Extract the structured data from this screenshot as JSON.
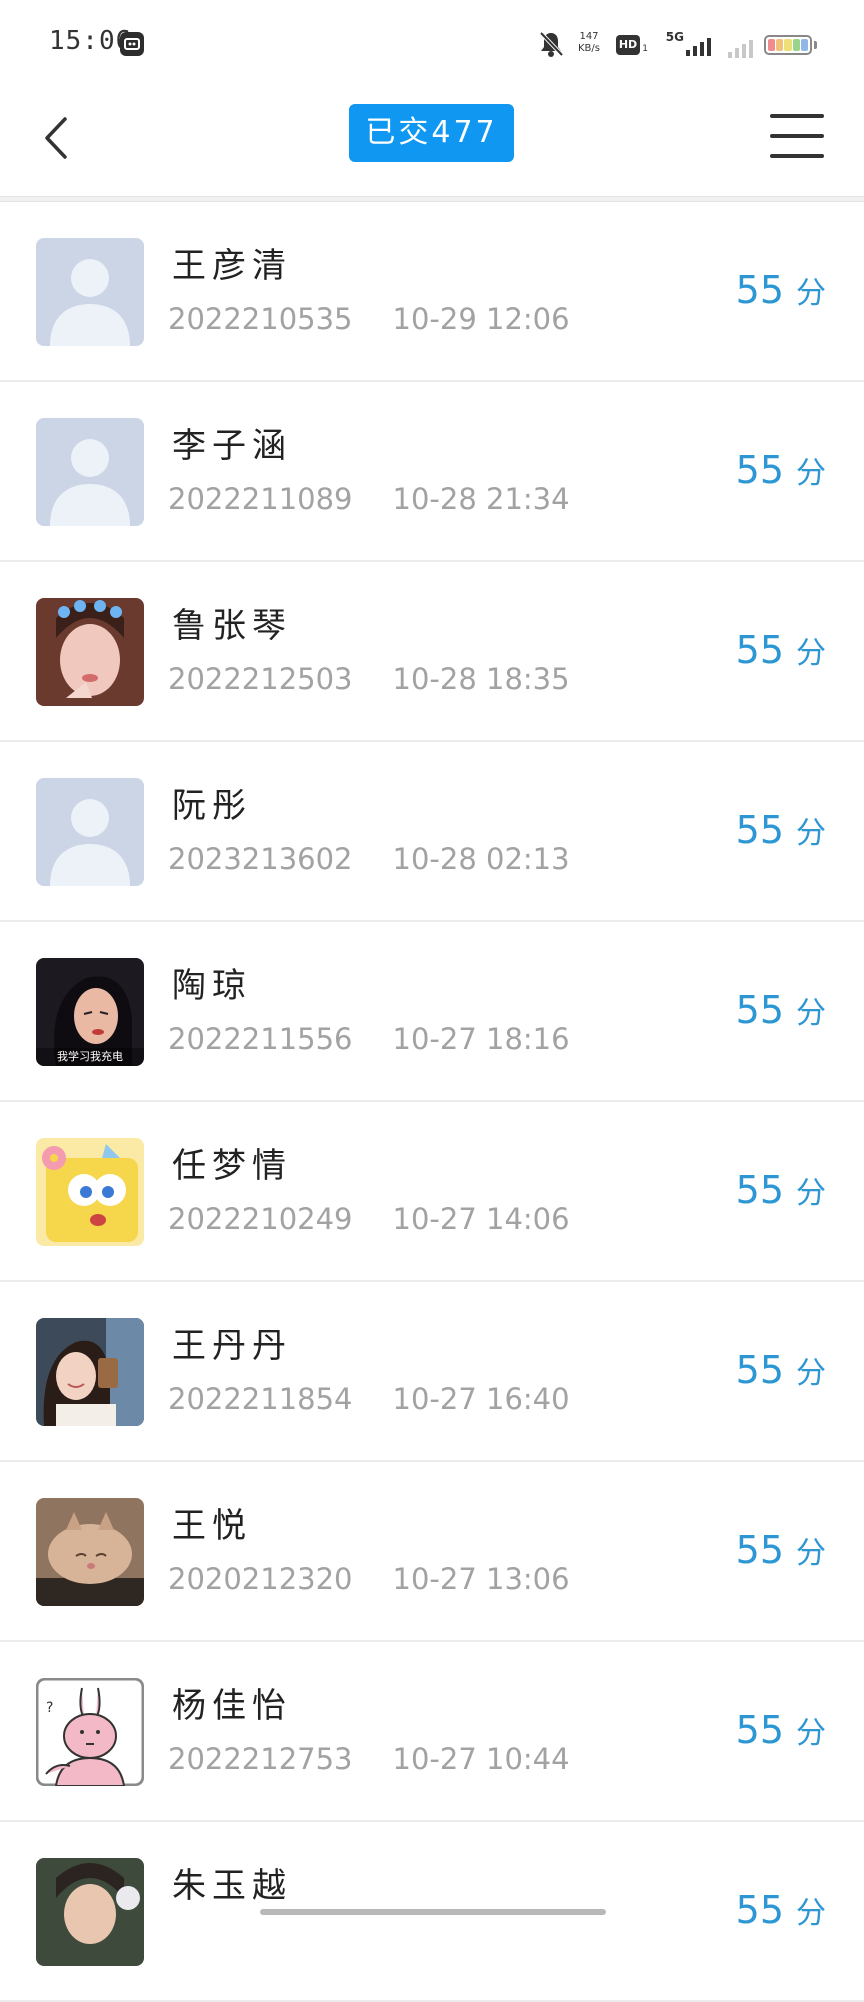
{
  "status_bar": {
    "time": "15:06",
    "net_speed_value": "147",
    "net_speed_unit": "KB/s",
    "hd_label": "HD",
    "hd_sub": "1",
    "network_label": "5G",
    "battery_colors": [
      "#f28b8b",
      "#f2c27a",
      "#ecdf77",
      "#9ad48b",
      "#8fb8e8"
    ]
  },
  "nav": {
    "title": "已交477"
  },
  "score_color": "#2d96d3",
  "accent_color": "#0f97f1",
  "rows": [
    {
      "name": "王彦清",
      "id": "2022210535",
      "date": "10-29 12:06",
      "score": "55",
      "unit": "分",
      "avatar": "default"
    },
    {
      "name": "李子涵",
      "id": "2022211089",
      "date": "10-28 21:34",
      "score": "55",
      "unit": "分",
      "avatar": "default"
    },
    {
      "name": "鲁张琴",
      "id": "2022212503",
      "date": "10-28 18:35",
      "score": "55",
      "unit": "分",
      "avatar": "photo-girl-crown"
    },
    {
      "name": "阮彤",
      "id": "2023213602",
      "date": "10-28 02:13",
      "score": "55",
      "unit": "分",
      "avatar": "default"
    },
    {
      "name": "陶琼",
      "id": "2022211556",
      "date": "10-27 18:16",
      "score": "55",
      "unit": "分",
      "avatar": "illustration-woman",
      "avatar_caption": "我学习我充电"
    },
    {
      "name": "任梦情",
      "id": "2022210249",
      "date": "10-27 14:06",
      "score": "55",
      "unit": "分",
      "avatar": "cartoon-sponge"
    },
    {
      "name": "王丹丹",
      "id": "2022211854",
      "date": "10-27 16:40",
      "score": "55",
      "unit": "分",
      "avatar": "photo-girl-cup"
    },
    {
      "name": "王悦",
      "id": "2020212320",
      "date": "10-27 13:06",
      "score": "55",
      "unit": "分",
      "avatar": "photo-cat"
    },
    {
      "name": "杨佳怡",
      "id": "2022212753",
      "date": "10-27 10:44",
      "score": "55",
      "unit": "分",
      "avatar": "cartoon-rabbit"
    },
    {
      "name": "朱玉越",
      "id": "",
      "date": "",
      "score": "55",
      "unit": "分",
      "avatar": "photo-partial"
    }
  ]
}
